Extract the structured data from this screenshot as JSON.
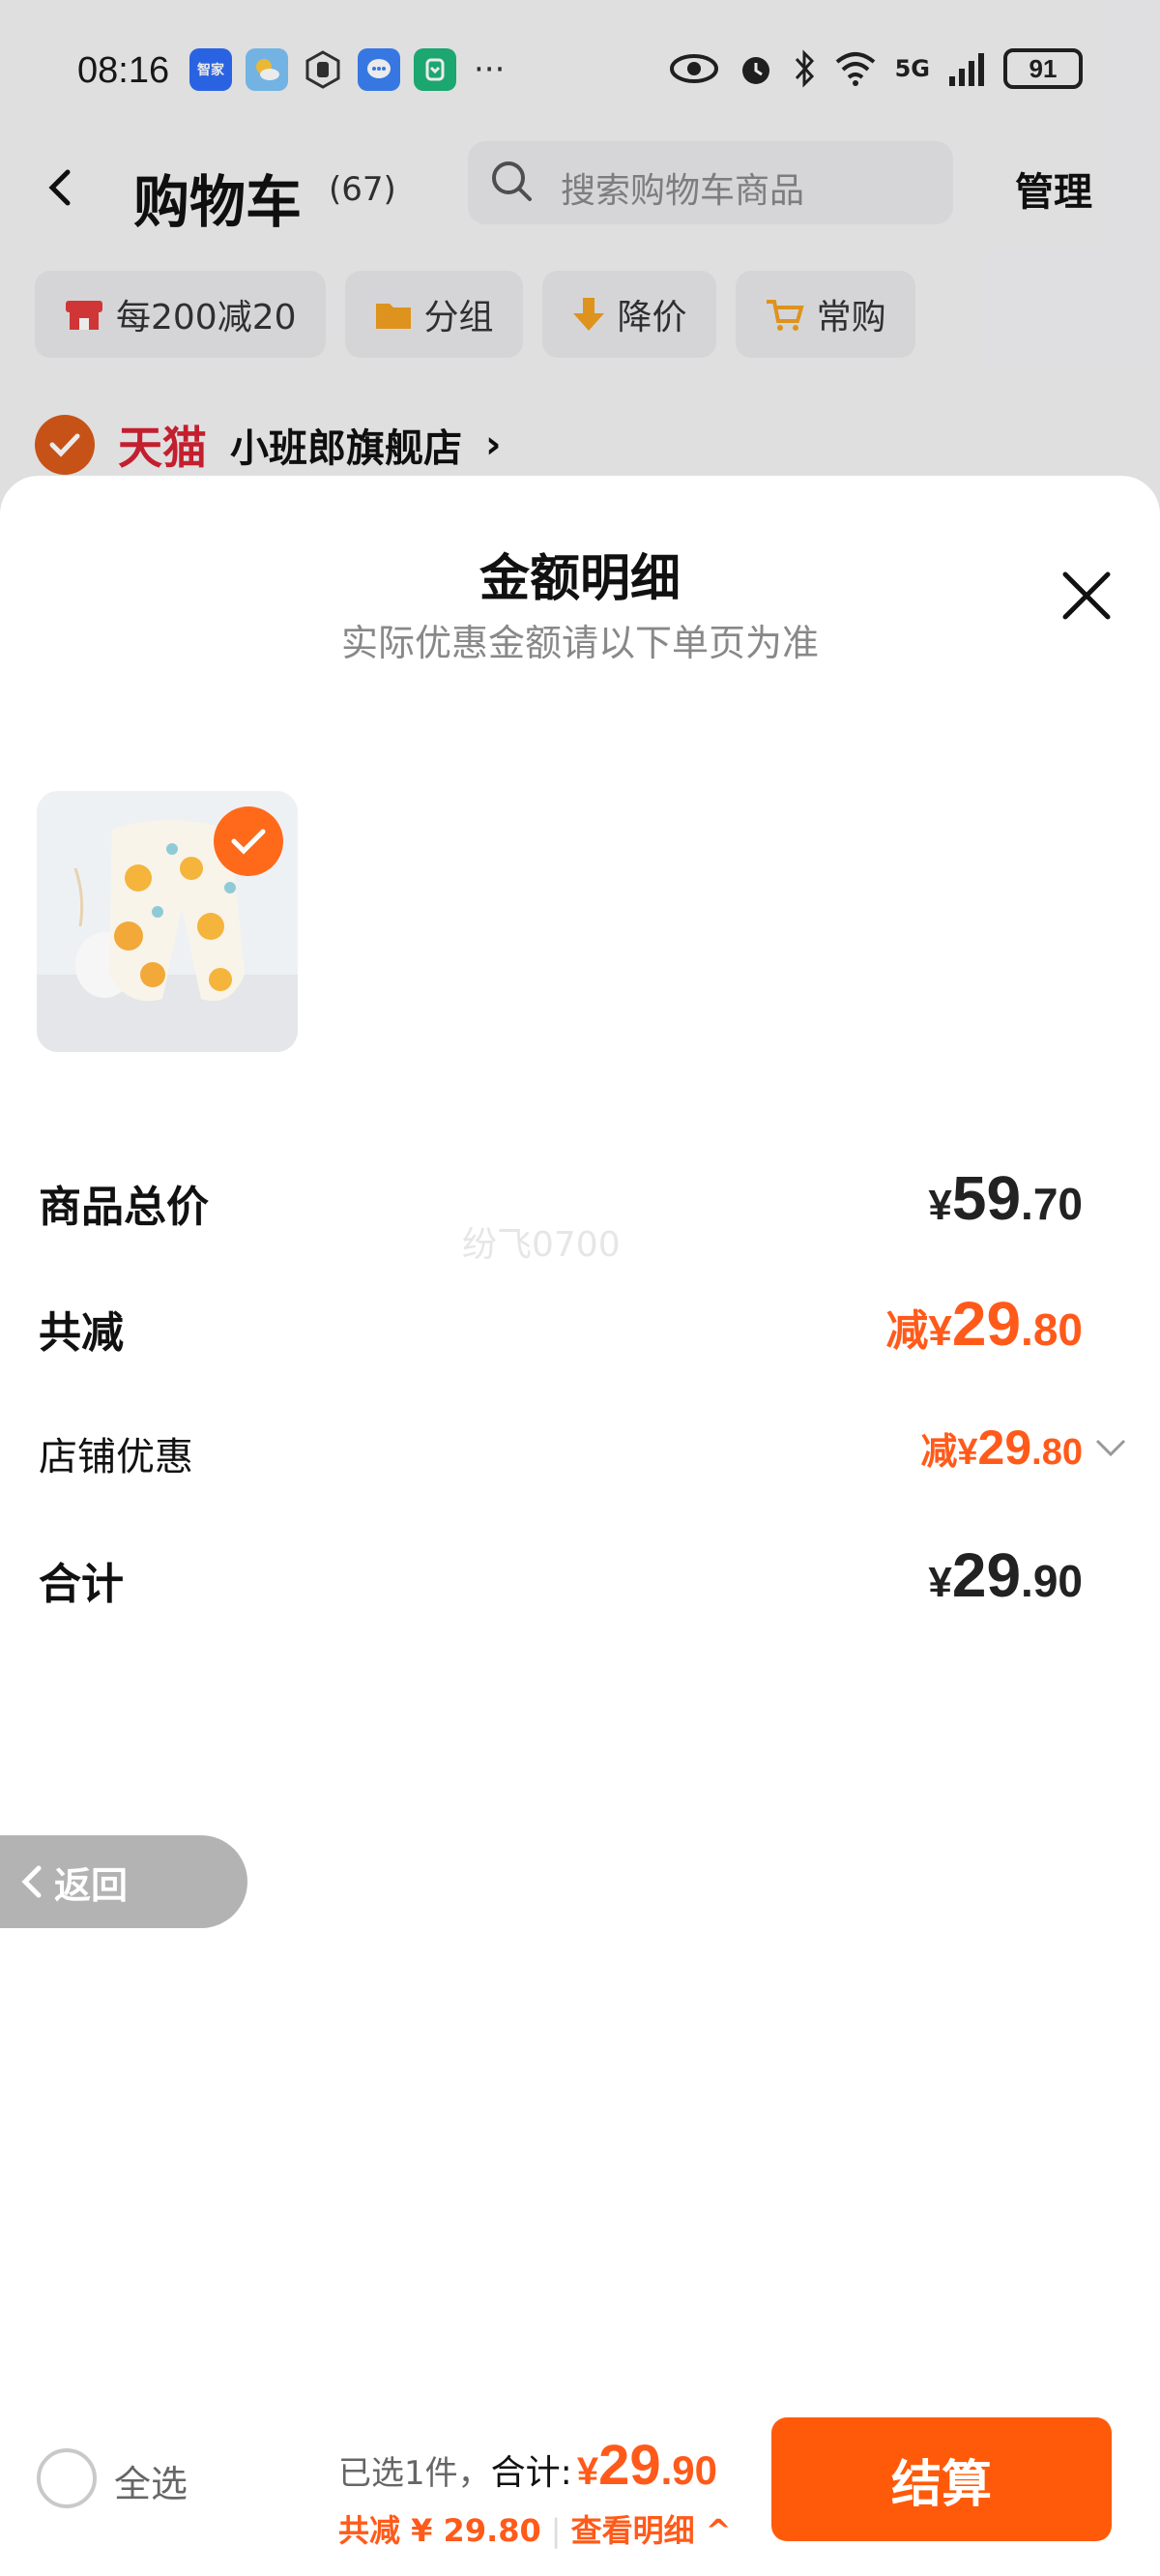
{
  "status_bar": {
    "time": "08:16",
    "apps": [
      {
        "icon": "zhijia-app-icon",
        "label": "智家",
        "color": "#2e6cf6"
      },
      {
        "icon": "weather-app-icon",
        "label": "",
        "color": "#3aa0f5"
      },
      {
        "icon": "hand-app-icon",
        "label": "",
        "color": "#555555"
      },
      {
        "icon": "message-app-icon",
        "label": "",
        "color": "#3b82f6"
      },
      {
        "icon": "mihome-app-icon",
        "label": "",
        "color": "#1fb57a"
      }
    ],
    "more": "···",
    "network": "5G",
    "battery": "91"
  },
  "nav": {
    "back_symbol": "‹",
    "title": "购物车",
    "count": "(67)",
    "search_placeholder": "搜索购物车商品",
    "manage": "管理"
  },
  "chips": [
    {
      "label": "每200减20",
      "icon": "store-icon",
      "color": "#e23b3b"
    },
    {
      "label": "分组",
      "icon": "folder-icon",
      "color": "#f0a020"
    },
    {
      "label": "降价",
      "icon": "price-down-icon",
      "color": "#f0a020"
    },
    {
      "label": "常购",
      "icon": "cart-plus-icon",
      "color": "#f0a020"
    }
  ],
  "store": {
    "brand": "天猫",
    "name": "小班郎旗舰店",
    "arrow": "›"
  },
  "sheet": {
    "title": "金额明细",
    "subtitle": "实际优惠金额请以下单页为准",
    "rows": {
      "goods_total": {
        "label": "商品总价",
        "sym": "¥",
        "int": "59",
        "dec": ".70"
      },
      "total_reduce": {
        "label": "共减",
        "prefix": "减",
        "sym": "¥",
        "int": "29",
        "dec": ".80"
      },
      "store_discount": {
        "label": "店铺优惠",
        "prefix": "减",
        "sym": "¥",
        "int": "29",
        "dec": ".80"
      },
      "sum": {
        "label": "合计",
        "sym": "¥",
        "int": "29",
        "dec": ".90"
      }
    },
    "watermark": "纷飞0700"
  },
  "return_pill": {
    "label": "返回"
  },
  "bottom_bar": {
    "select_all": "全选",
    "selected": "已选1件，",
    "total_label": "合计:",
    "price_sym": "¥",
    "price_int": "29",
    "price_dec": ".90",
    "reduce_text": "共减 ¥ 29.80",
    "sep": "|",
    "detail_text": "查看明细 ^",
    "checkout": "结算"
  },
  "colors": {
    "accent": "#ff5a0a",
    "tmall_red": "#d42232"
  }
}
